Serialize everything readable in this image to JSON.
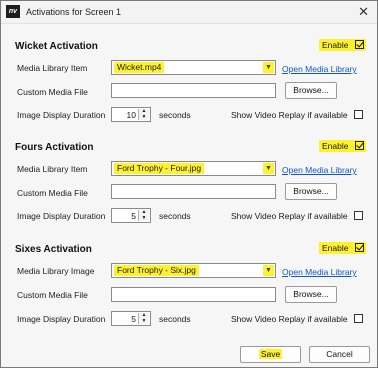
{
  "window": {
    "app_icon_text": "nv",
    "title": "Activations for Screen 1"
  },
  "sections": [
    {
      "title": "Wicket Activation",
      "enable_label": "Enable",
      "enabled": true,
      "media_label": "Media Library Item",
      "media_value": "Wicket.mp4",
      "open_link": "Open Media Library",
      "custom_label": "Custom Media File",
      "custom_value": "",
      "browse_label": "Browse...",
      "duration_label": "Image Display Duration",
      "duration_value": "10",
      "seconds_label": "seconds",
      "replay_label": "Show Video Replay if available",
      "replay_checked": false
    },
    {
      "title": "Fours Activation",
      "enable_label": "Enable",
      "enabled": true,
      "media_label": "Media Library Item",
      "media_value": "Ford Trophy - Four.jpg",
      "open_link": "Open Media Library",
      "custom_label": "Custom Media File",
      "custom_value": "",
      "browse_label": "Browse...",
      "duration_label": "Image Display Duration",
      "duration_value": "5",
      "seconds_label": "seconds",
      "replay_label": "Show Video Replay if available",
      "replay_checked": false
    },
    {
      "title": "Sixes Activation",
      "enable_label": "Enable",
      "enabled": true,
      "media_label": "Media Library Image",
      "media_value": "Ford Trophy - Six.jpg",
      "open_link": "Open Media Library",
      "custom_label": "Custom Media File",
      "custom_value": "",
      "browse_label": "Browse...",
      "duration_label": "Image Display Duration",
      "duration_value": "5",
      "seconds_label": "seconds",
      "replay_label": "Show Video Replay if available",
      "replay_checked": false
    }
  ],
  "footer": {
    "save_label": "Save",
    "cancel_label": "Cancel"
  },
  "colors": {
    "highlight": "#fff12e",
    "link": "#1155cc",
    "window_bg": "#f6f6f6"
  },
  "icons": {
    "close": "close-icon",
    "dropdown": "chevron-down-icon",
    "spinner": "spinner-arrows-icon"
  }
}
